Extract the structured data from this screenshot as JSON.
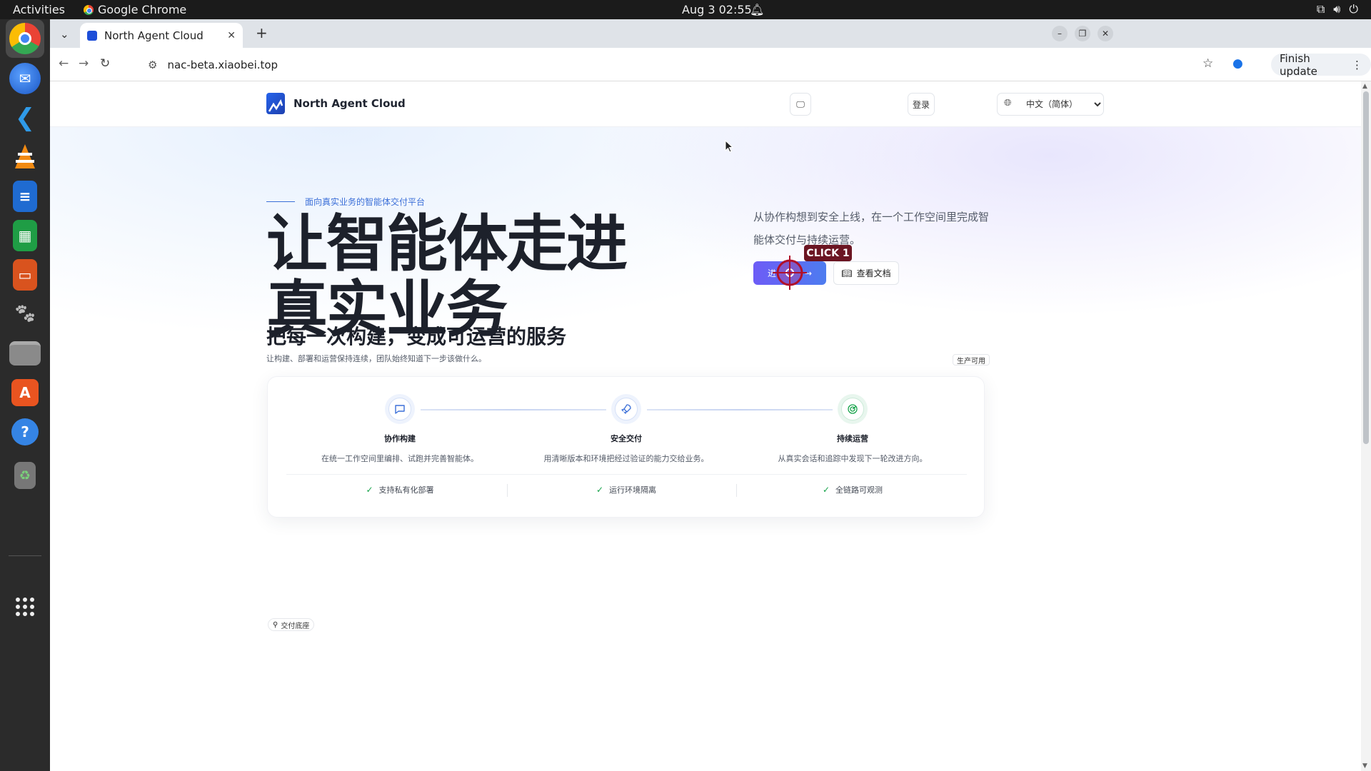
{
  "system": {
    "activities": "Activities",
    "app_name": "Google Chrome",
    "clock": "Aug 3  02:55"
  },
  "dock": {
    "items": [
      "chrome-icon",
      "thunderbird-icon",
      "vscode-icon",
      "vlc-icon",
      "writer-icon",
      "calc-icon",
      "impress-icon",
      "gimp-icon",
      "files-icon",
      "software-icon",
      "help-icon",
      "trash-icon",
      "app-grid-icon"
    ]
  },
  "browser": {
    "tab_title": "North Agent Cloud",
    "url": "nac-beta.xiaobei.top",
    "finish_update": "Finish update"
  },
  "site": {
    "brand": "North Agent Cloud",
    "language": "中文（简体）",
    "login": "登录",
    "eyebrow": "面向真实业务的智能体交付平台",
    "headline_line1": "让智能体走进",
    "headline_line2": "真实业务",
    "lead": "从协作构想到安全上线，在一个工作空间里完成智能体交付与持续运营。",
    "cta_primary": "进",
    "cta_docs": "查看文档",
    "section_title": "把每一次构建，变成可运营的服务",
    "section_sub": "让构建、部署和运营保持连续，团队始终知道下一步该做什么。",
    "prod_badge": "生产可用",
    "steps": [
      {
        "title": "协作构建",
        "desc": "在统一工作空间里编排、试跑并完善智能体。"
      },
      {
        "title": "安全交付",
        "desc": "用清晰版本和环境把经过验证的能力交给业务。"
      },
      {
        "title": "持续运营",
        "desc": "从真实会话和追踪中发现下一轮改进方向。"
      }
    ],
    "features": [
      "支持私有化部署",
      "运行环境隔离",
      "全链路可观测"
    ],
    "footer_badge": "交付底座"
  },
  "overlay": {
    "click_label": "CLICK 1"
  },
  "colors": {
    "accent_start": "#6d5cf6",
    "accent_end": "#4d7cf0",
    "click_tag": "#6b1522",
    "check": "#16a34a"
  }
}
